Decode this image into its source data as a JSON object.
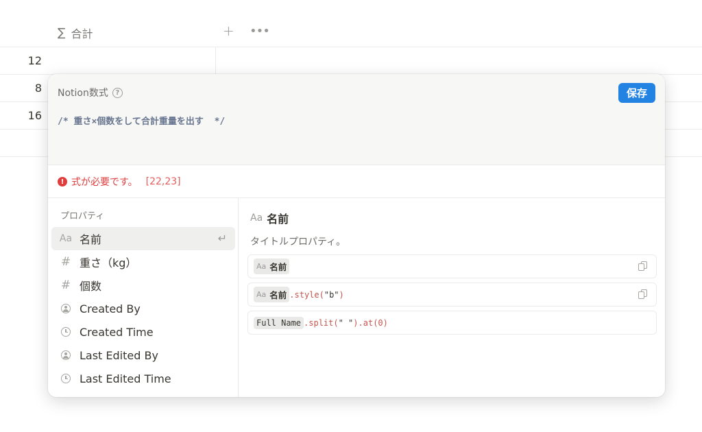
{
  "table": {
    "column_title": "合計",
    "column_icon": "sigma-icon",
    "add_label": "+",
    "more_label": "•••",
    "rows": [
      {
        "value": "12"
      },
      {
        "value": "8"
      },
      {
        "value": "16"
      }
    ]
  },
  "editor": {
    "title": "Notion数式",
    "help_label": "?",
    "save_label": "保存",
    "code": "/* 重さ×個数をして合計重量を出す  */"
  },
  "error": {
    "icon_label": "!",
    "message": "式が必要です。",
    "position": "[22,23]"
  },
  "properties": {
    "section_label": "プロパティ",
    "items": [
      {
        "icon": "text-aa-icon",
        "icon_label": "Aa",
        "label": "名前"
      },
      {
        "icon": "hash-icon",
        "icon_label": "#",
        "label": "重さ（kg）"
      },
      {
        "icon": "hash-icon",
        "icon_label": "#",
        "label": "個数"
      },
      {
        "icon": "user-circle-icon",
        "label": "Created By"
      },
      {
        "icon": "clock-icon",
        "label": "Created Time"
      },
      {
        "icon": "user-circle-icon",
        "label": "Last Edited By"
      },
      {
        "icon": "clock-icon",
        "label": "Last Edited Time"
      }
    ],
    "enter_label": "↵"
  },
  "detail": {
    "icon_label": "Aa",
    "title": "名前",
    "description": "タイトルプロパティ。",
    "examples": [
      {
        "chip_icon": "Aa",
        "chip": "名前",
        "suffix_method": "",
        "suffix_arg": "",
        "suffix_rest": ""
      },
      {
        "chip_icon": "Aa",
        "chip": "名前",
        "suffix_method": ".style(",
        "suffix_arg": "\"b\"",
        "suffix_rest": ")"
      },
      {
        "chip": "Full Name",
        "suffix_method": ".split(",
        "suffix_arg": "\" \"",
        "suffix_rest": ").at(0)"
      }
    ]
  },
  "colors": {
    "accent": "#2383e2",
    "error": "#e03e3e"
  }
}
